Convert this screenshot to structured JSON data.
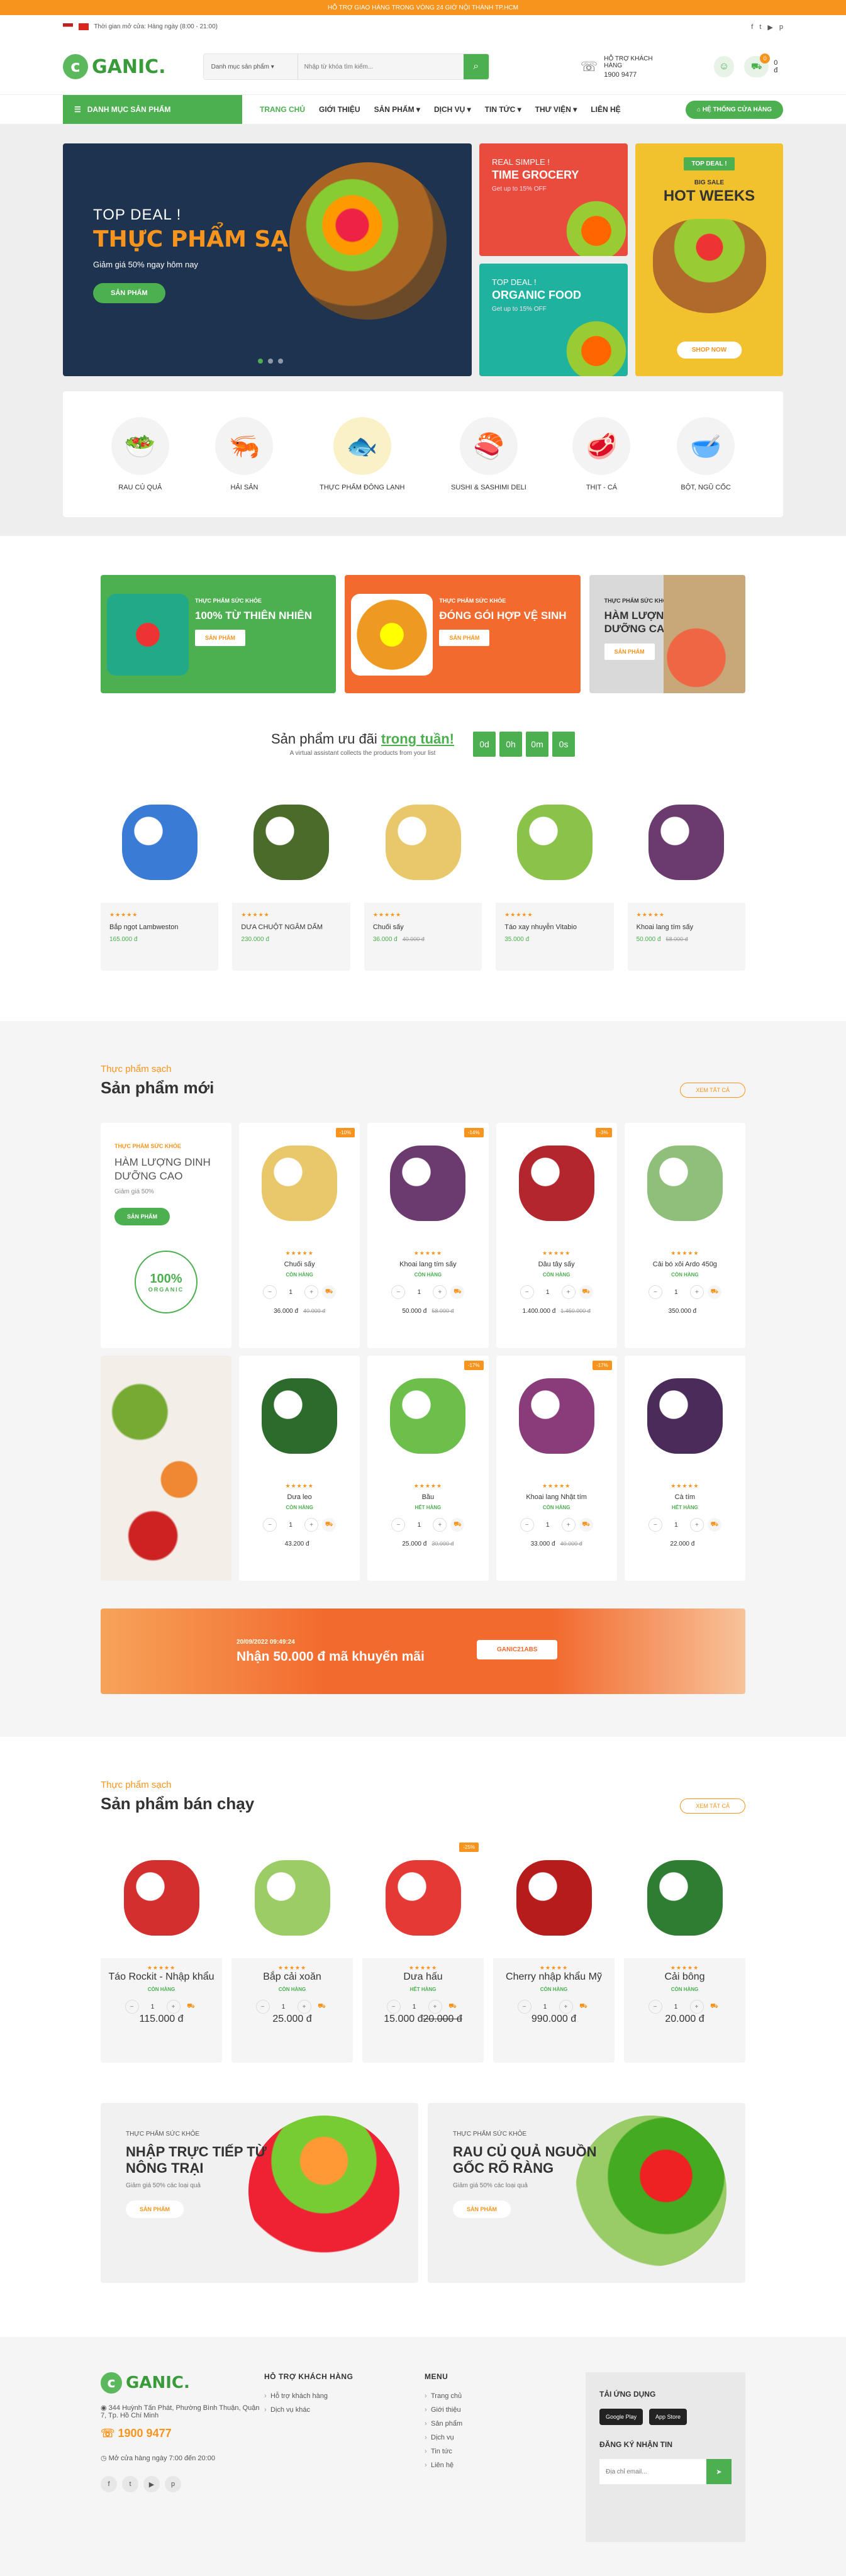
{
  "topbar": {
    "text": "HỖ TRỢ GIAO HÀNG TRONG VÒNG 24 GIỜ NỘI THÀNH TP.HCM"
  },
  "header": {
    "hours": "Thời gian mở cửa: Hàng ngày (8:00 - 21:00)",
    "search_cat": "Danh mục sản phẩm",
    "search_placeholder": "Nhập từ khóa tìm kiếm...",
    "support_label": "HỖ TRỢ KHÁCH HÀNG",
    "support_phone": "1900 9477",
    "cart_count": "0",
    "cart_total": "0 đ"
  },
  "nav": {
    "categories": "DANH MỤC SẢN PHẨM",
    "items": [
      "TRANG CHỦ",
      "GIỚI THIỆU",
      "SẢN PHẨM",
      "DỊCH VỤ",
      "TIN TỨC",
      "THƯ VIỆN",
      "LIÊN HỆ"
    ],
    "store": "HỆ THỐNG CỬA HÀNG"
  },
  "hero": {
    "top": "TOP DEAL !",
    "title": "THỰC PHẨM SẠCH",
    "sub": "Giảm giá 50% ngay hôm nay",
    "btn": "SẢN PHẨM",
    "tile1": {
      "s": "REAL SIMPLE !",
      "t": "TIME GROCERY",
      "u": "Get up to 15% OFF"
    },
    "tile2": {
      "s": "TOP DEAL !",
      "t": "ORGANIC FOOD",
      "u": "Get up to 15% OFF"
    },
    "tall": {
      "tag": "TOP DEAL !",
      "s": "BIG SALE",
      "t": "HOT WEEKS",
      "btn": "SHOP NOW"
    }
  },
  "categories": [
    "RAU CỦ QUẢ",
    "HẢI SẢN",
    "THỰC PHẨM ĐÔNG LẠNH",
    "SUSHI & SASHIMI DELI",
    "THỊT - CÁ",
    "BỘT, NGŨ CỐC"
  ],
  "promos": [
    {
      "s": "THỰC PHẨM SỨC KHỎE",
      "t": "100% TỪ THIÊN NHIÊN",
      "b": "SẢN PHẨM"
    },
    {
      "s": "THỰC PHẨM SỨC KHỎE",
      "t": "ĐÓNG GÓI HỢP VỆ SINH",
      "b": "SẢN PHẨM"
    },
    {
      "s": "THỰC PHẨM SỨC KHỎE",
      "t": "HÀM LƯỢNG DINH DƯỠNG CAO",
      "b": "SẢN PHẨM"
    }
  ],
  "deal": {
    "title_a": "Sản phẩm ưu đãi ",
    "title_b": "trong tuần!",
    "sub": "A virtual assistant collects the products from your list",
    "countdown": [
      "0d",
      "0h",
      "0m",
      "0s"
    ],
    "items": [
      {
        "nm": "Bắp ngọt Lambweston",
        "pr": "165.000 đ",
        "old": ""
      },
      {
        "nm": "DƯA CHUỘT NGÂM DẤM",
        "pr": "230.000 đ",
        "old": ""
      },
      {
        "nm": "Chuối sấy",
        "pr": "36.000 đ",
        "old": "40.000 đ"
      },
      {
        "nm": "Táo xay nhuyễn Vitabio",
        "pr": "35.000 đ",
        "old": ""
      },
      {
        "nm": "Khoai lang tím sấy",
        "pr": "50.000 đ",
        "old": "58.000 đ"
      }
    ]
  },
  "newp": {
    "small": "Thực phẩm sạch",
    "title": "Sản phẩm mới",
    "viewall": "XEM TẤT CẢ",
    "side": {
      "s": "THỰC PHẨM SỨC KHỎE",
      "t": "HÀM LƯỢNG DINH DƯỠNG CAO",
      "u": "Giảm giá 50%",
      "b": "SẢN PHẨM",
      "badge": "100%",
      "badge_sub": "ORGANIC"
    },
    "items": [
      {
        "nm": "Chuối sấy",
        "st": "CÒN HÀNG",
        "pr": "36.000 đ",
        "old": "40.000 đ",
        "d": "-10%"
      },
      {
        "nm": "Khoai lang tím sấy",
        "st": "CÒN HÀNG",
        "pr": "50.000 đ",
        "old": "58.000 đ",
        "d": "-14%"
      },
      {
        "nm": "Dâu tây sấy",
        "st": "CÒN HÀNG",
        "pr": "1.400.000 đ",
        "old": "1.450.000 đ",
        "d": "-3%"
      },
      {
        "nm": "Cải bó xôi Ardo 450g",
        "st": "CÒN HÀNG",
        "pr": "350.000 đ",
        "old": "",
        "d": ""
      },
      {
        "nm": "Dưa leo",
        "st": "CÒN HÀNG",
        "pr": "43.200 đ",
        "old": "",
        "d": ""
      },
      {
        "nm": "Bầu",
        "st": "HẾT HÀNG",
        "pr": "25.000 đ",
        "old": "30.000 đ",
        "d": "-17%"
      },
      {
        "nm": "Khoai lang Nhật tím",
        "st": "CÒN HÀNG",
        "pr": "33.000 đ",
        "old": "40.000 đ",
        "d": "-17%"
      },
      {
        "nm": "Cà tím",
        "st": "HẾT HÀNG",
        "pr": "22.000 đ",
        "old": "",
        "d": ""
      }
    ]
  },
  "coupon": {
    "date": "20/09/2022 09:49:24",
    "title": "Nhận 50.000 đ  mã khuyến mãi",
    "code": "GANIC21ABS"
  },
  "best": {
    "small": "Thực phẩm sạch",
    "title": "Sản phẩm bán chạy",
    "viewall": "XEM TẤT CẢ",
    "items": [
      {
        "nm": "Táo Rockit - Nhập khẩu",
        "st": "CÒN HÀNG",
        "pr": "115.000 đ",
        "old": "",
        "d": ""
      },
      {
        "nm": "Bắp cải xoăn",
        "st": "CÒN HÀNG",
        "pr": "25.000 đ",
        "old": "",
        "d": ""
      },
      {
        "nm": "Dưa hấu",
        "st": "HẾT HÀNG",
        "pr": "15.000 đ",
        "old": "20.000 đ",
        "d": "-25%"
      },
      {
        "nm": "Cherry nhập khẩu Mỹ",
        "st": "CÒN HÀNG",
        "pr": "990.000 đ",
        "old": "",
        "d": ""
      },
      {
        "nm": "Cải bông",
        "st": "CÒN HÀNG",
        "pr": "20.000 đ",
        "old": "",
        "d": ""
      }
    ]
  },
  "banners": [
    {
      "s": "THỰC PHẨM SỨC KHỎE",
      "t": "NHẬP TRỰC TIẾP TỪ NÔNG TRẠI",
      "u": "Giảm giá 50% các loại quả",
      "b": "SẢN PHẨM"
    },
    {
      "s": "THỰC PHẨM SỨC KHỎE",
      "t": "RAU CỦ QUẢ NGUỒN GỐC RÕ RÀNG",
      "u": "Giảm giá 50% các loại quả",
      "b": "SẢN PHẨM"
    }
  ],
  "footer": {
    "address": "344 Huỳnh Tấn Phát, Phường Bình Thuận, Quận 7, Tp. Hồ Chí Minh",
    "phone": "1900 9477",
    "hours": "Mở cửa hàng ngày 7:00 đến 20:00",
    "support_title": "HỖ TRỢ KHÁCH HÀNG",
    "support": [
      "Hỗ trợ khách hàng",
      "Dịch vụ khác"
    ],
    "menu_title": "MENU",
    "menu": [
      "Trang chủ",
      "Giới thiệu",
      "Sản phẩm",
      "Dịch vụ",
      "Tin tức",
      "Liên hệ"
    ],
    "app_title": "TẢI ỨNG DỤNG",
    "gplay": "Google Play",
    "appstore": "App Store",
    "nl_title": "ĐĂNG KÝ NHẬN TIN",
    "nl_placeholder": "Địa chỉ email..."
  },
  "brand": {
    "logo": "GANIC."
  }
}
